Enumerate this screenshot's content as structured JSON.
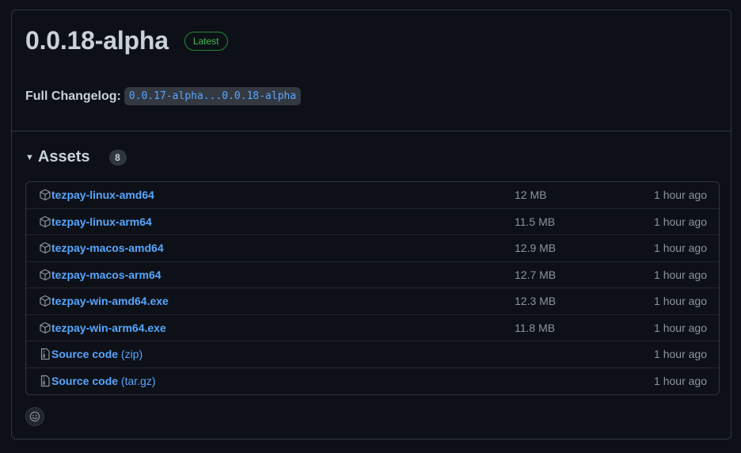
{
  "release": {
    "title": "0.0.18-alpha",
    "badge": "Latest",
    "changelog_label": "Full Changelog:",
    "changelog_link": "0.0.17-alpha...0.0.18-alpha"
  },
  "assets": {
    "title": "Assets",
    "count": "8",
    "items": [
      {
        "name": "tezpay-linux-amd64",
        "suffix": "",
        "size": "12 MB",
        "time": "1 hour ago",
        "icon": "package-icon"
      },
      {
        "name": "tezpay-linux-arm64",
        "suffix": "",
        "size": "11.5 MB",
        "time": "1 hour ago",
        "icon": "package-icon"
      },
      {
        "name": "tezpay-macos-amd64",
        "suffix": "",
        "size": "12.9 MB",
        "time": "1 hour ago",
        "icon": "package-icon"
      },
      {
        "name": "tezpay-macos-arm64",
        "suffix": "",
        "size": "12.7 MB",
        "time": "1 hour ago",
        "icon": "package-icon"
      },
      {
        "name": "tezpay-win-amd64.exe",
        "suffix": "",
        "size": "12.3 MB",
        "time": "1 hour ago",
        "icon": "package-icon"
      },
      {
        "name": "tezpay-win-arm64.exe",
        "suffix": "",
        "size": "11.8 MB",
        "time": "1 hour ago",
        "icon": "package-icon"
      },
      {
        "name": "Source code",
        "suffix": " (zip)",
        "size": "",
        "time": "1 hour ago",
        "icon": "file-zip-icon"
      },
      {
        "name": "Source code",
        "suffix": " (tar.gz)",
        "size": "",
        "time": "1 hour ago",
        "icon": "file-zip-icon"
      }
    ]
  },
  "colors": {
    "background": "#0d1117",
    "border": "#30363d",
    "link": "#58a6ff",
    "muted": "#8b949e",
    "success": "#3fb950"
  }
}
